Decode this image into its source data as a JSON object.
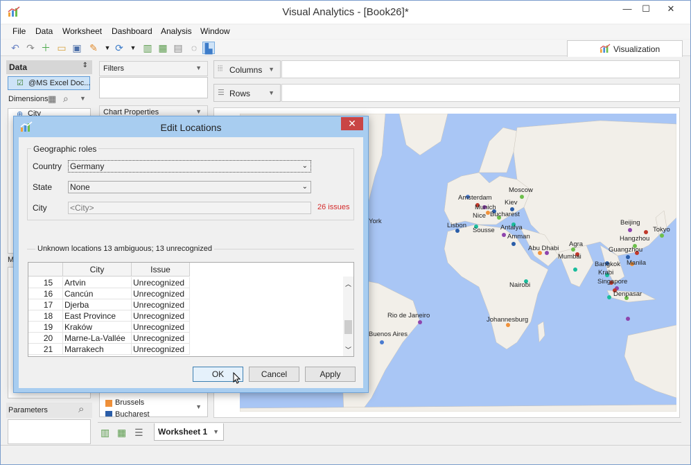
{
  "window": {
    "title": "Visual Analytics - [Book26]*",
    "minimize": "—",
    "maximize": "☐",
    "close": "✕"
  },
  "menu": [
    "File",
    "Data",
    "Worksheet",
    "Dashboard",
    "Analysis",
    "Window"
  ],
  "viz_tab": "Visualization",
  "left_panel": {
    "data_header": "Data",
    "datasource": "@MS Excel Doc...",
    "dimensions_label": "Dimensions",
    "dimension_first": "City",
    "measures_label": "M",
    "parameters_label": "Parameters"
  },
  "middle_panel": {
    "filters": "Filters",
    "chart_properties": "Chart Properties",
    "legend_items": [
      {
        "label": "Brussels",
        "color": "#f0913a"
      },
      {
        "label": "Bucharest",
        "color": "#2a5da8"
      }
    ]
  },
  "shelves": {
    "columns": "Columns",
    "rows": "Rows"
  },
  "worksheet_tab": "Worksheet 1",
  "map_labels": [
    "York",
    "Moscow",
    "Amsterdam",
    "Kiev",
    "Munich",
    "Nice",
    "Bucharest",
    "Lisbon",
    "Sousse",
    "Antalya",
    "Amman",
    "Abu Dhabi",
    "Agra",
    "Mumbai",
    "Beijing",
    "Tokyo",
    "Hangzhou",
    "Guangzhou",
    "Manila",
    "Bangkok",
    "Krabi",
    "Singapore",
    "Denpasar",
    "Nairobi",
    "Rio de Janeiro",
    "Johannesburg",
    "Buenos Aires"
  ],
  "dialog": {
    "title": "Edit Locations",
    "close": "✕",
    "geo_roles_label": "Geographic roles",
    "country_label": "Country",
    "country_value": "Germany",
    "state_label": "State",
    "state_value": "None",
    "city_label": "City",
    "city_value": "<City>",
    "issues": "26 issues",
    "unknown_label": "Unknown locations  13 ambiguous; 13 unrecognized",
    "table": {
      "headers": [
        "",
        "City",
        "Issue"
      ],
      "rows": [
        {
          "num": "15",
          "city": "Artvin",
          "issue": "Unrecognized"
        },
        {
          "num": "16",
          "city": "Cancún",
          "issue": "Unrecognized"
        },
        {
          "num": "17",
          "city": "Djerba",
          "issue": "Unrecognized"
        },
        {
          "num": "18",
          "city": "East Province",
          "issue": "Unrecognized"
        },
        {
          "num": "19",
          "city": "Kraków",
          "issue": "Unrecognized"
        },
        {
          "num": "20",
          "city": "Marne-La-Vallée",
          "issue": "Unrecognized"
        },
        {
          "num": "21",
          "city": "Marrakech",
          "issue": "Unrecognized"
        }
      ]
    },
    "ok": "OK",
    "cancel": "Cancel",
    "apply": "Apply"
  }
}
